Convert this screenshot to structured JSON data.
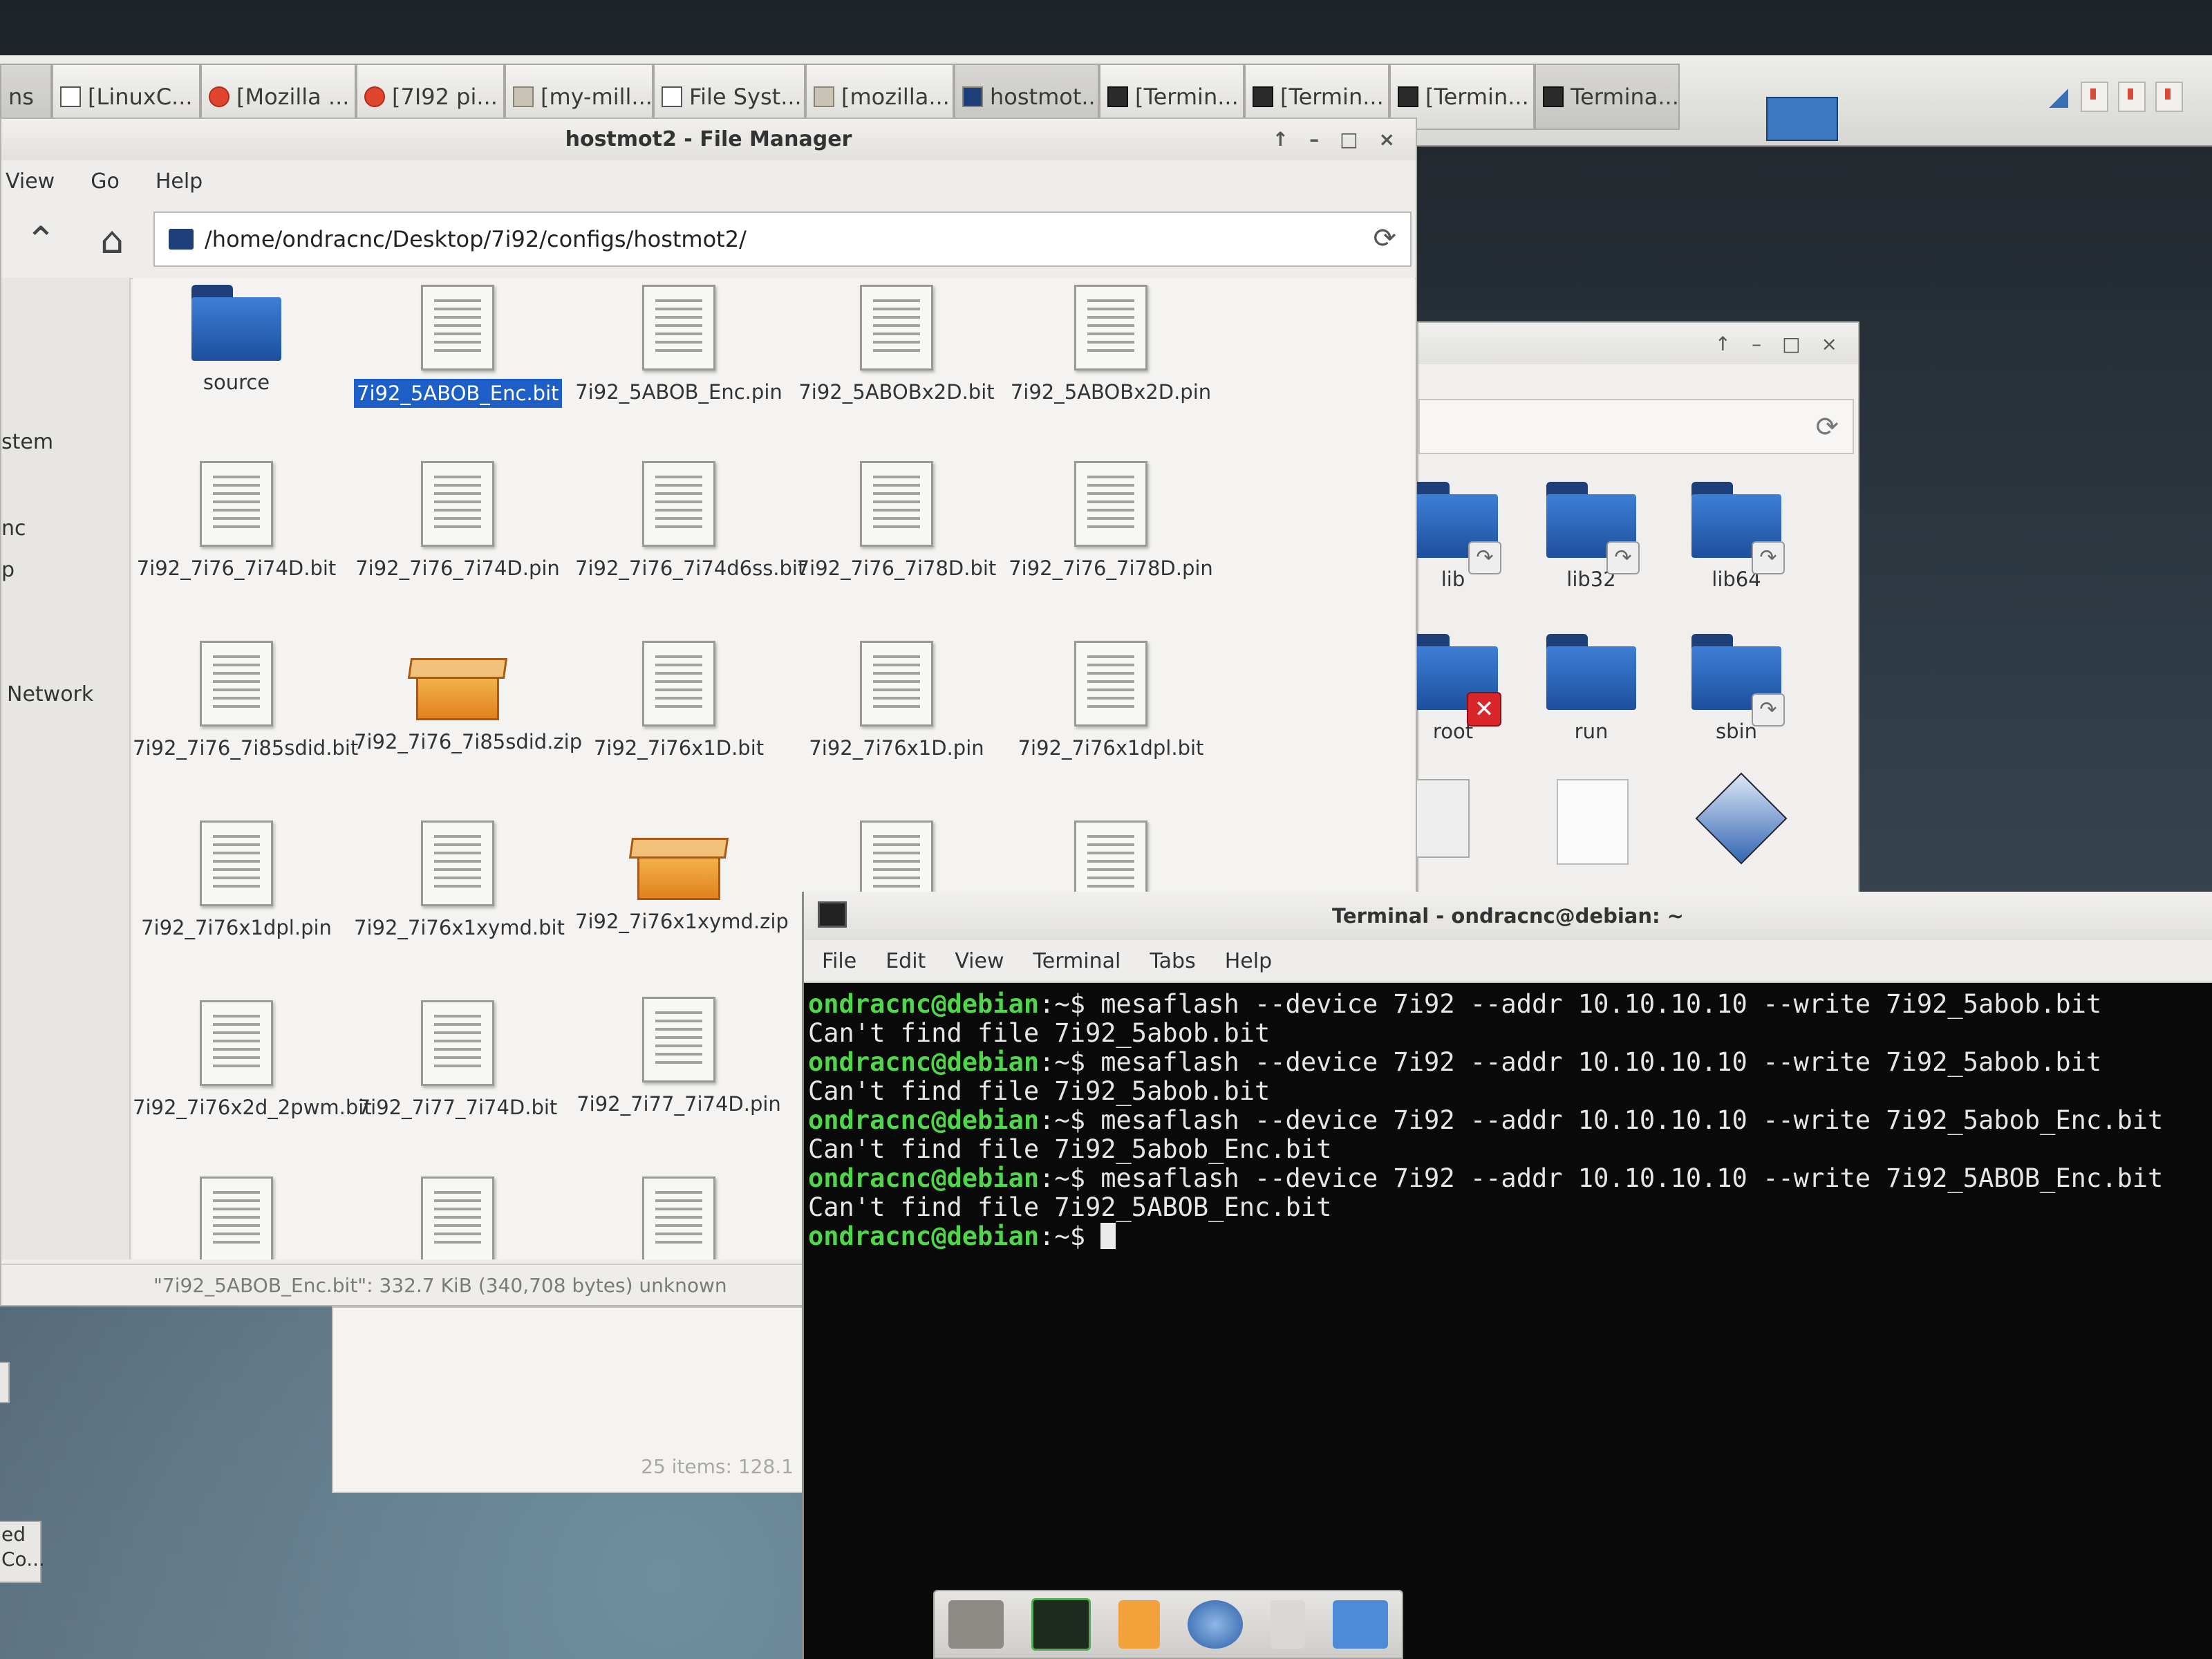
{
  "taskbar": {
    "tasks": [
      {
        "label": "ns",
        "icon": "none"
      },
      {
        "label": "[LinuxC...",
        "icon": "window"
      },
      {
        "label": "[Mozilla ...",
        "icon": "firefox"
      },
      {
        "label": "[7I92 pi...",
        "icon": "firefox"
      },
      {
        "label": "[my-mill...",
        "icon": "folder"
      },
      {
        "label": "File Syst...",
        "icon": "window"
      },
      {
        "label": "[mozilla...",
        "icon": "folder"
      },
      {
        "label": "hostmot...",
        "icon": "folder"
      },
      {
        "label": "[Termin...",
        "icon": "terminal"
      },
      {
        "label": "[Termin...",
        "icon": "terminal"
      },
      {
        "label": "[Termin...",
        "icon": "terminal"
      },
      {
        "label": "Termina...",
        "icon": "terminal"
      }
    ]
  },
  "file_manager": {
    "title": "hostmot2 - File Manager",
    "window_buttons": [
      "↑",
      "–",
      "□",
      "×"
    ],
    "menu": [
      "View",
      "Go",
      "Help"
    ],
    "path": "/home/ondracnc/Desktop/7i92/configs/hostmot2/",
    "sidebar": [
      "stem",
      "nc",
      "p",
      "Network"
    ],
    "files": [
      {
        "name": "source",
        "type": "folder"
      },
      {
        "name": "7i92_5ABOB_Enc.bit",
        "type": "doc",
        "selected": true
      },
      {
        "name": "7i92_5ABOB_Enc.pin",
        "type": "doc"
      },
      {
        "name": "7i92_5ABOBx2D.bit",
        "type": "doc"
      },
      {
        "name": "7i92_5ABOBx2D.pin",
        "type": "doc"
      },
      {
        "name": "7i92_7i76_7i74D.bit",
        "type": "doc"
      },
      {
        "name": "7i92_7i76_7i74D.pin",
        "type": "doc"
      },
      {
        "name": "7i92_7i76_7i74d6ss.bit",
        "type": "doc"
      },
      {
        "name": "7i92_7i76_7i78D.bit",
        "type": "doc"
      },
      {
        "name": "7i92_7i76_7i78D.pin",
        "type": "doc"
      },
      {
        "name": "7i92_7i76_7i85sdid.bit",
        "type": "doc"
      },
      {
        "name": "7i92_7i76_7i85sdid.zip",
        "type": "zip"
      },
      {
        "name": "7i92_7i76x1D.bit",
        "type": "doc"
      },
      {
        "name": "7i92_7i76x1D.pin",
        "type": "doc"
      },
      {
        "name": "7i92_7i76x1dpl.bit",
        "type": "doc"
      },
      {
        "name": "7i92_7i76x1dpl.pin",
        "type": "doc"
      },
      {
        "name": "7i92_7i76x1xymd.bit",
        "type": "doc"
      },
      {
        "name": "7i92_7i76x1xymd.zip",
        "type": "zip"
      },
      {
        "name": "7i92_7i76x2d_2pwm.bit",
        "type": "doc"
      },
      {
        "name": "7i92_7i77_7i74D.bit",
        "type": "doc"
      },
      {
        "name": "7i92_7i77_7i74D.pin",
        "type": "doc"
      }
    ],
    "status": "\"7i92_5ABOB_Enc.bit\": 332.7 KiB (340,708 bytes) unknown"
  },
  "file_manager_2": {
    "window_buttons": [
      "↑",
      "–",
      "□",
      "×"
    ],
    "items": [
      {
        "name": "lib",
        "badge": "link"
      },
      {
        "name": "lib32",
        "badge": "link"
      },
      {
        "name": "lib64",
        "badge": "link"
      },
      {
        "name": "root",
        "badge": "x"
      },
      {
        "name": "run",
        "badge": ""
      },
      {
        "name": "sbin",
        "badge": "link"
      }
    ]
  },
  "panel2": {
    "status": "25 items: 128.1"
  },
  "terminal": {
    "title": "Terminal - ondracnc@debian: ~",
    "menu": [
      "File",
      "Edit",
      "View",
      "Terminal",
      "Tabs",
      "Help"
    ],
    "lines": [
      {
        "prompt": "ondracnc@debian",
        "suffix": ":~$ ",
        "text": "mesaflash --device 7i92 --addr 10.10.10.10 --write 7i92_5abob.bit"
      },
      {
        "prompt": "",
        "suffix": "",
        "text": "Can't find file 7i92_5abob.bit"
      },
      {
        "prompt": "ondracnc@debian",
        "suffix": ":~$ ",
        "text": "mesaflash --device 7i92 --addr 10.10.10.10 --write 7i92_5abob.bit"
      },
      {
        "prompt": "",
        "suffix": "",
        "text": "Can't find file 7i92_5abob.bit"
      },
      {
        "prompt": "ondracnc@debian",
        "suffix": ":~$ ",
        "text": "mesaflash --device 7i92 --addr 10.10.10.10 --write 7i92_5abob_Enc.bit"
      },
      {
        "prompt": "",
        "suffix": "",
        "text": "Can't find file 7i92_5abob_Enc.bit"
      },
      {
        "prompt": "ondracnc@debian",
        "suffix": ":~$ ",
        "text": "mesaflash --device 7i92 --addr 10.10.10.10 --write 7i92_5ABOB_Enc.bit"
      },
      {
        "prompt": "",
        "suffix": "",
        "text": "Can't find file 7i92_5ABOB_Enc.bit"
      },
      {
        "prompt": "ondracnc@debian",
        "suffix": ":~$ ",
        "text": ""
      }
    ]
  },
  "left_widgets": [
    "ed\nCo..."
  ]
}
